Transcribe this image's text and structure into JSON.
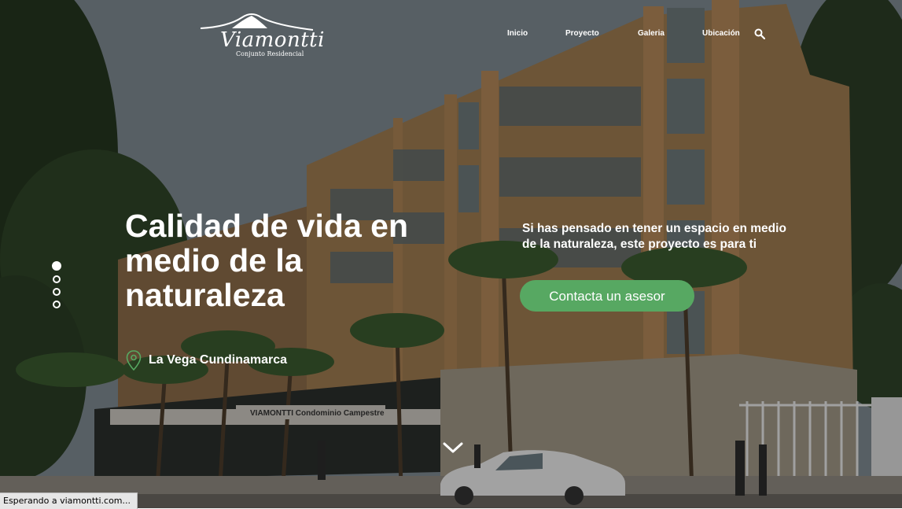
{
  "brand": {
    "name": "Viamontti",
    "tagline": "Conjunto Residencial"
  },
  "nav": {
    "items": [
      {
        "label": "Inicio"
      },
      {
        "label": "Proyecto"
      },
      {
        "label": "Galeria"
      },
      {
        "label": "Ubicación"
      }
    ],
    "search_icon": "search-icon"
  },
  "slider": {
    "slides": 4,
    "active_slide": 1
  },
  "hero": {
    "headline": "Calidad de vida en medio de la naturaleza",
    "location": "La Vega Cundinamarca",
    "intro": "Si has pensado en tener un espacio en medio de la naturaleza, este proyecto es para ti",
    "cta_label": "Contacta un asesor",
    "cta_color": "#57a862",
    "building_sign": "VIAMONTTI  Condominio Campestre"
  },
  "status_bar": {
    "text": "Esperando a viamontti.com..."
  }
}
